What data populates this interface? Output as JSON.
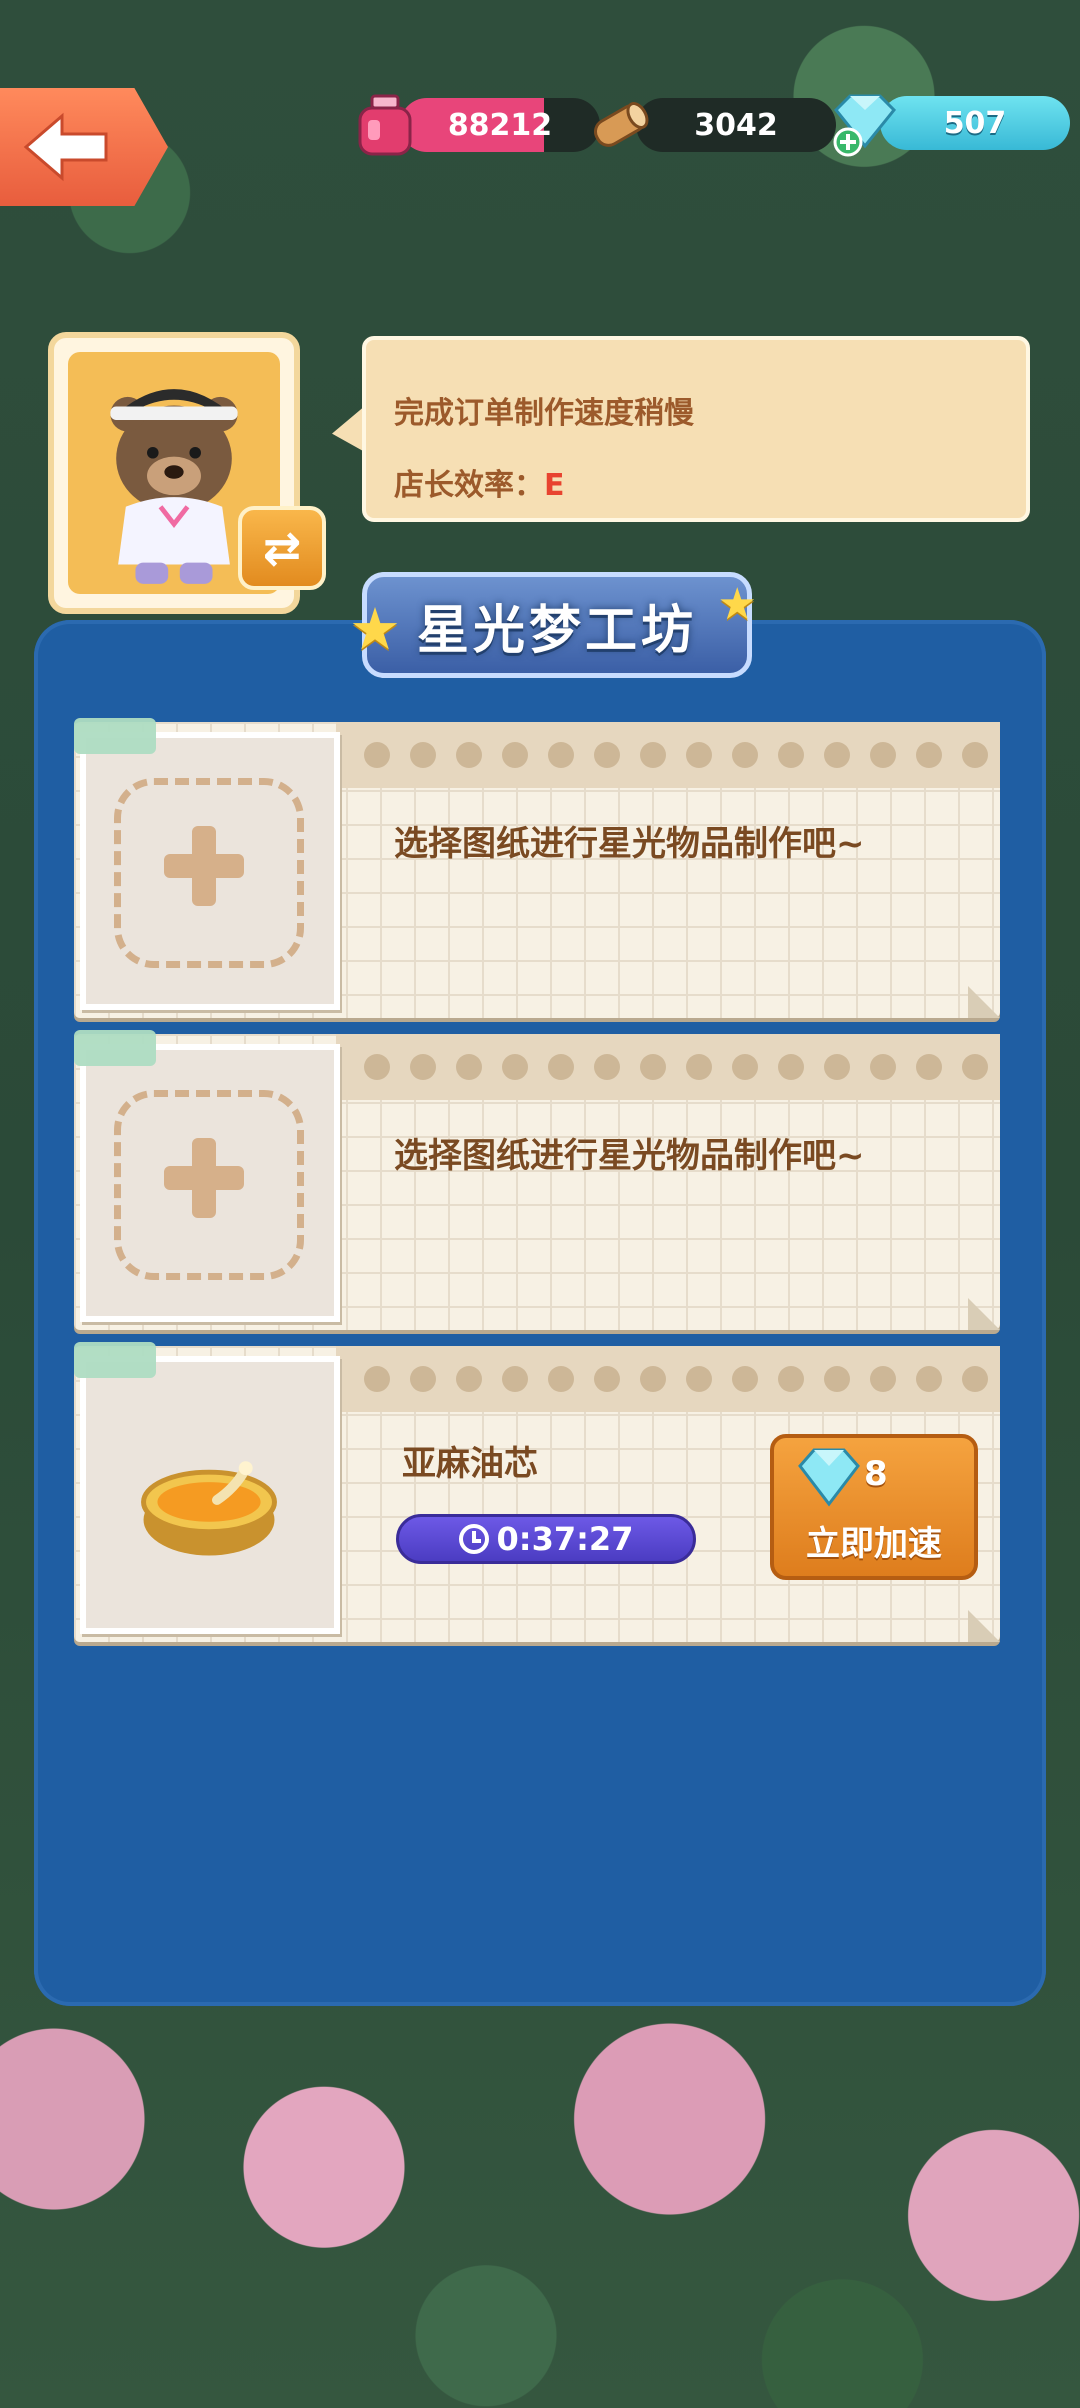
{
  "header": {
    "resources": [
      {
        "name": "ink-bottle",
        "value": "88212",
        "color": "#e8457a"
      },
      {
        "name": "wood-log",
        "value": "3042"
      },
      {
        "name": "diamond",
        "value": "507",
        "color": "#4cc7e0"
      }
    ]
  },
  "manager": {
    "speech_line1": "完成订单制作速度稍慢",
    "efficiency_label": "店长效率：",
    "efficiency_grade": "E"
  },
  "workshop": {
    "title": "星光梦工坊",
    "slots": [
      {
        "state": "empty",
        "text": "选择图纸进行星光物品制作吧~"
      },
      {
        "state": "empty",
        "text": "选择图纸进行星光物品制作吧~"
      },
      {
        "state": "crafting",
        "item_name": "亚麻油芯",
        "timer": "0:37:27",
        "speedup_cost": "8",
        "speedup_label": "立即加速"
      }
    ]
  }
}
